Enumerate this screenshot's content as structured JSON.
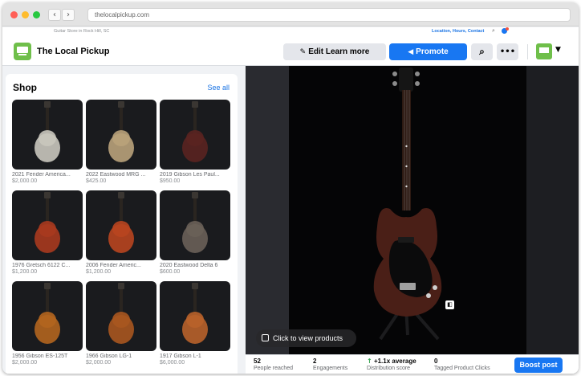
{
  "browser": {
    "url": "thelocalpickup.com",
    "back_icon": "chevron-left-icon",
    "forward_icon": "chevron-right-icon"
  },
  "banner": {
    "tagline": "Guitar Store in Rock Hill, SC",
    "links": "Location, Hours, Contact"
  },
  "header": {
    "page_name": "The Local Pickup",
    "edit_label": "Edit Learn more",
    "promote_label": "Promote",
    "search_icon": "search-icon",
    "more_icon": "more-icon"
  },
  "shop": {
    "title": "Shop",
    "see_all": "See all",
    "products": [
      {
        "name": "2021 Fender America...",
        "price": "$2,000.00",
        "color": "#c9c6bc"
      },
      {
        "name": "2022 Eastwood MRG ...",
        "price": "$425.00",
        "color": "#b9a27a"
      },
      {
        "name": "2019 Gibson Les Paul...",
        "price": "$950.00",
        "color": "#5a2420"
      },
      {
        "name": "1976 Gretsch 6122 C...",
        "price": "$1,200.00",
        "color": "#a83a1e"
      },
      {
        "name": "2006 Fender Americ...",
        "price": "$1,200.00",
        "color": "#b8451f"
      },
      {
        "name": "2020 Eastwood Delta 6",
        "price": "$600.00",
        "color": "#6a6058"
      },
      {
        "name": "1956 Gibson ES-125T",
        "price": "$2,000.00",
        "color": "#b2651e"
      },
      {
        "name": "1966 Gibson LG-1",
        "price": "$2,000.00",
        "color": "#a9561f"
      },
      {
        "name": "1917 Gibson L-1",
        "price": "$6,000.00",
        "color": "#b8622a"
      }
    ]
  },
  "photo": {
    "cta": "Click to view products"
  },
  "stats": {
    "reached_value": "52",
    "reached_label": "People reached",
    "engagements_value": "2",
    "engagements_label": "Engagements",
    "distribution_value": "+1.1x average",
    "distribution_label": "Distribution score",
    "clicks_value": "0",
    "clicks_label": "Tagged Product Clicks",
    "boost_label": "Boost post"
  }
}
